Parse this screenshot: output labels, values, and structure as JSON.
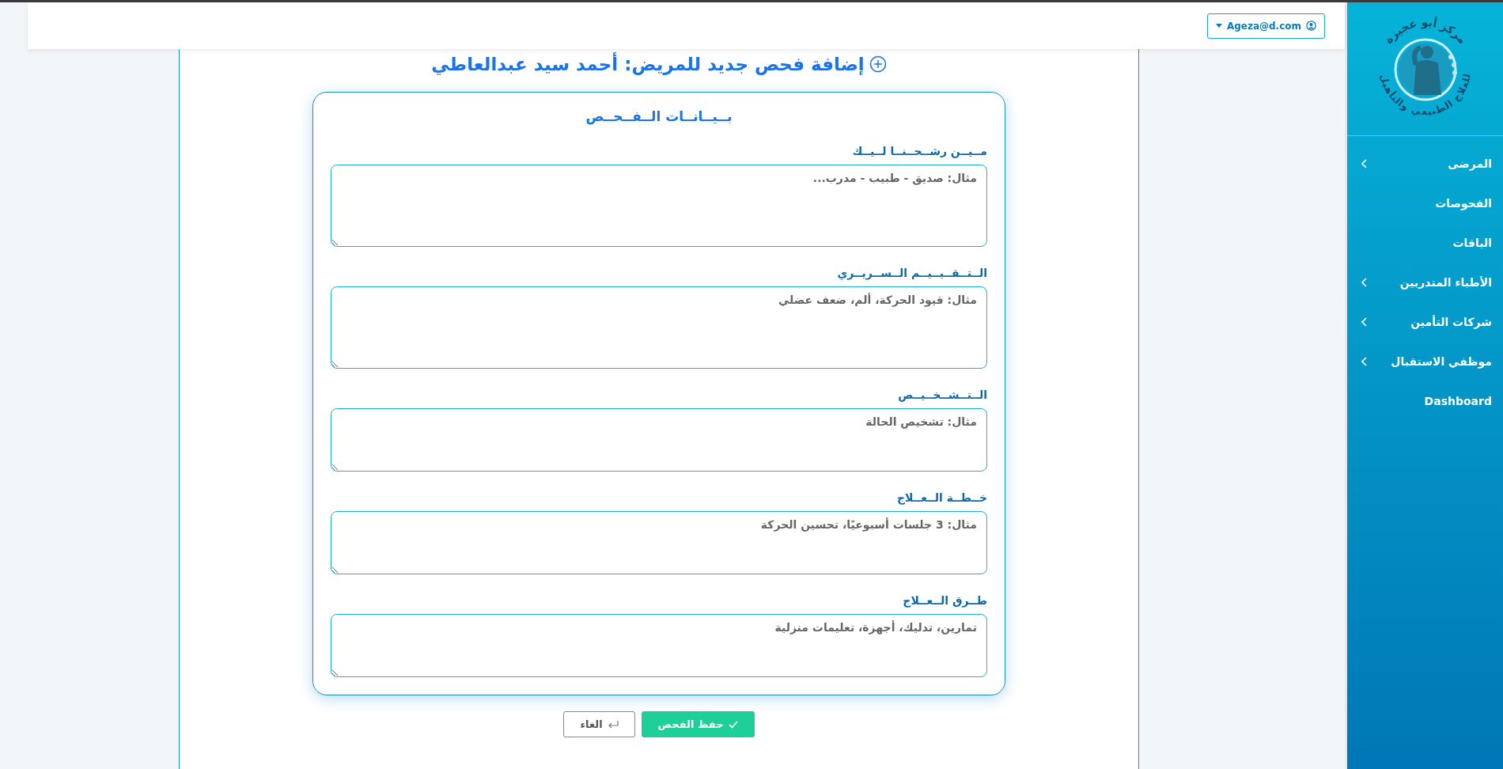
{
  "header": {
    "user_menu": {
      "label": "Ageza@d.com"
    }
  },
  "sidebar": {
    "logo": {
      "title": "مركز أبو عجيزة",
      "subtitle": "للعلاج الطبيعي والتأهيل"
    },
    "items": [
      {
        "label": "المرضى",
        "has_submenu": true
      },
      {
        "label": "الفحوصات",
        "has_submenu": false
      },
      {
        "label": "الباقات",
        "has_submenu": false
      },
      {
        "label": "الأطباء المتدربين",
        "has_submenu": true
      },
      {
        "label": "شركات التأمين",
        "has_submenu": true
      },
      {
        "label": "موظفي الاستقبال",
        "has_submenu": true
      },
      {
        "label": "Dashboard",
        "has_submenu": false
      }
    ]
  },
  "page_title": "إضافة فحص جديد للمريض: أحمد سيد عبدالعاطي",
  "form": {
    "title": "بــيــانــات الــفــحــص",
    "fields": [
      {
        "label": "مــيــن رشــحــنــا لــيــك",
        "placeholder": "مثال: صديق - طبيب - مدرب..."
      },
      {
        "label": "الــتــقــيــيــم الــســريــري",
        "placeholder": "مثال: قيود الحركة، ألم، ضعف عضلي"
      },
      {
        "label": "الــتــشــخــيــص",
        "placeholder": "مثال: تشخيص الحالة"
      },
      {
        "label": "خــطــة الــعــلاج",
        "placeholder": "مثال: 3 جلسات أسبوعيًا، تحسين الحركة"
      },
      {
        "label": "طــرق الــعــلاج",
        "placeholder": "تمارين، تدليك، أجهزة، تعليمات منزلية"
      }
    ]
  },
  "buttons": [
    {
      "kind": "primary",
      "label": "حفظ الفحص"
    },
    {
      "kind": "secondary",
      "label": "الغاء"
    }
  ]
}
